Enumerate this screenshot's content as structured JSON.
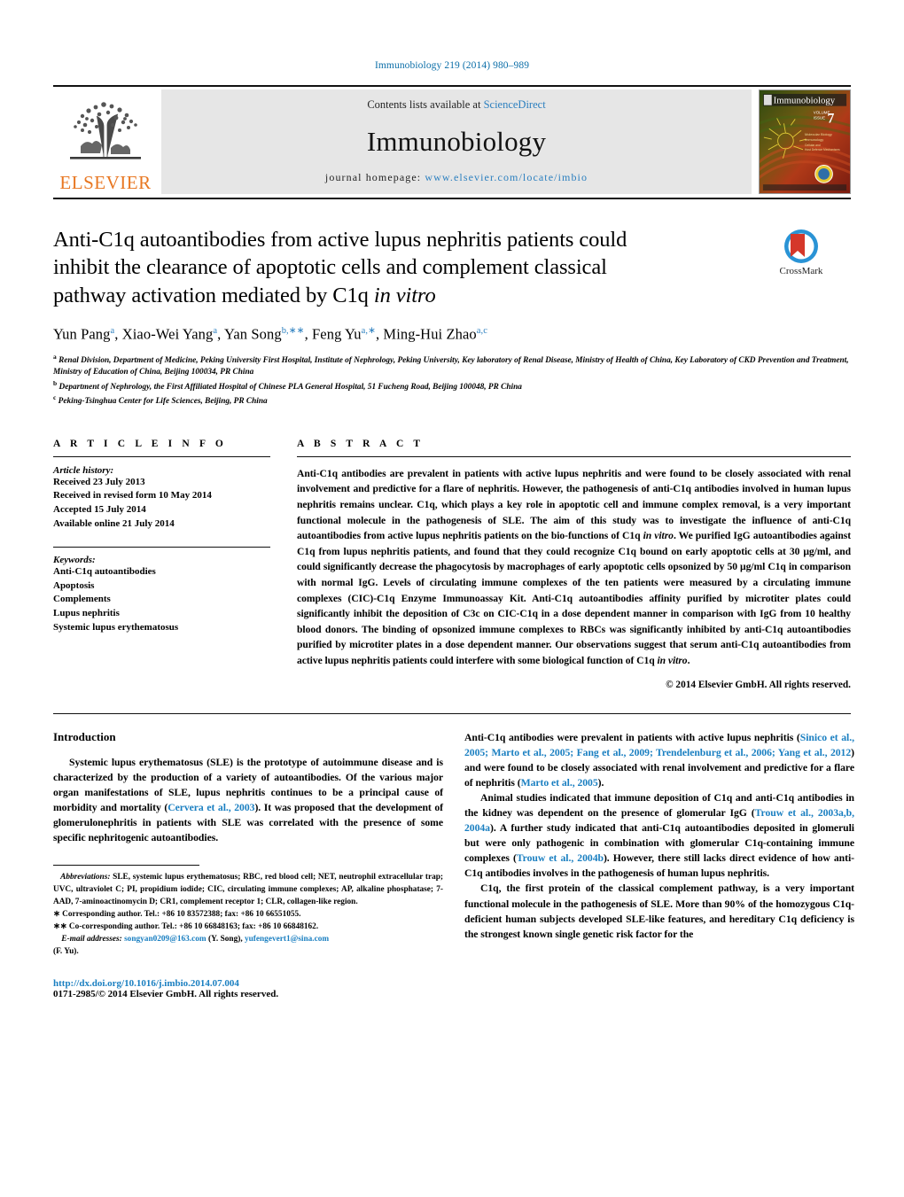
{
  "running_head": "Immunobiology 219 (2014) 980–989",
  "masthead": {
    "publisher": "ELSEVIER",
    "contents_prefix": "Contents lists available at ",
    "contents_link": "ScienceDirect",
    "journal_name": "Immunobiology",
    "homepage_prefix": "journal homepage: ",
    "homepage_url": "www.elsevier.com/locate/imbio",
    "cover_title": "Immunobiology",
    "cover_issue": "7"
  },
  "crossmark": {
    "label": "CrossMark"
  },
  "article": {
    "title_line1": "Anti-C1q autoantibodies from active lupus nephritis patients could",
    "title_line2": "inhibit the clearance of apoptotic cells and complement classical",
    "title_line3_a": "pathway activation mediated by C1q ",
    "title_line3_italic": "in vitro",
    "authors": [
      {
        "name": "Yun Pang",
        "marks": "a"
      },
      {
        "name": "Xiao-Wei Yang",
        "marks": "a"
      },
      {
        "name": "Yan Song",
        "marks": "b,∗∗"
      },
      {
        "name": "Feng Yu",
        "marks": "a,∗"
      },
      {
        "name": "Ming-Hui Zhao",
        "marks": "a,c"
      }
    ],
    "affiliations": [
      {
        "mark": "a",
        "text": "Renal Division, Department of Medicine, Peking University First Hospital, Institute of Nephrology, Peking University, Key laboratory of Renal Disease, Ministry of Health of China, Key Laboratory of CKD Prevention and Treatment, Ministry of Education of China, Beijing 100034, PR China"
      },
      {
        "mark": "b",
        "text": "Department of Nephrology, the First Affiliated Hospital of Chinese PLA General Hospital, 51 Fucheng Road, Beijing 100048, PR China"
      },
      {
        "mark": "c",
        "text": "Peking-Tsinghua Center for Life Sciences, Beijing, PR China"
      }
    ]
  },
  "article_info": {
    "heading": "A R T I C L E   I N F O",
    "history_label": "Article history:",
    "history": [
      "Received 23 July 2013",
      "Received in revised form 10 May 2014",
      "Accepted 15 July 2014",
      "Available online 21 July 2014"
    ],
    "keywords_label": "Keywords:",
    "keywords": [
      "Anti-C1q autoantibodies",
      "Apoptosis",
      "Complements",
      "Lupus nephritis",
      "Systemic lupus erythematosus"
    ]
  },
  "abstract": {
    "heading": "A B S T R A C T",
    "part1": "Anti-C1q antibodies are prevalent in patients with active lupus nephritis and were found to be closely associated with renal involvement and predictive for a flare of nephritis. However, the pathogenesis of anti-C1q antibodies involved in human lupus nephritis remains unclear. C1q, which plays a key role in apoptotic cell and immune complex removal, is a very important functional molecule in the pathogenesis of SLE. The aim of this study was to investigate the influence of anti-C1q autoantibodies from active lupus nephritis patients on the bio-functions of C1q ",
    "italic1": "in vitro",
    "part2": ". We purified IgG autoantibodies against C1q from lupus nephritis patients, and found that they could recognize C1q bound on early apoptotic cells at 30 μg/ml, and could significantly decrease the phagocytosis by macrophages of early apoptotic cells opsonized by 50 μg/ml C1q in comparison with normal IgG. Levels of circulating immune complexes of the ten patients were measured by a circulating immune complexes (CIC)-C1q Enzyme Immunoassay Kit. Anti-C1q autoantibodies affinity purified by microtiter plates could significantly inhibit the deposition of C3c on CIC-C1q in a dose dependent manner in comparison with IgG from 10 healthy blood donors. The binding of opsonized immune complexes to RBCs was significantly inhibited by anti-C1q autoantibodies purified by microtiter plates in a dose dependent manner. Our observations suggest that serum anti-C1q autoantibodies from active lupus nephritis patients could interfere with some biological function of C1q ",
    "italic2": "in vitro",
    "part3": ".",
    "copyright": "© 2014 Elsevier GmbH. All rights reserved."
  },
  "introduction": {
    "heading": "Introduction",
    "left_p1_a": "Systemic lupus erythematosus (SLE) is the prototype of autoimmune disease and is characterized by the production of a variety of autoantibodies. Of the various major organ manifestations of SLE, lupus nephritis continues to be a principal cause of morbidity and mortality (",
    "left_p1_cite": "Cervera et al., 2003",
    "left_p1_b": "). It was proposed that the development of glomerulonephritis in patients with SLE was correlated with the presence of some specific nephritogenic autoantibodies.",
    "right_p1_a": "Anti-C1q antibodies were prevalent in patients with active lupus nephritis (",
    "right_p1_cite": "Sinico et al., 2005; Marto et al., 2005; Fang et al., 2009; Trendelenburg et al., 2006; Yang et al., 2012",
    "right_p1_b": ") and were found to be closely associated with renal involvement and predictive for a flare of nephritis (",
    "right_p1_cite2": "Marto et al., 2005",
    "right_p1_c": ").",
    "right_p2_a": "Animal studies indicated that immune deposition of C1q and anti-C1q antibodies in the kidney was dependent on the presence of glomerular IgG (",
    "right_p2_cite": "Trouw et al., 2003a,b, 2004a",
    "right_p2_b": "). A further study indicated that anti-C1q autoantibodies deposited in glomeruli but were only pathogenic in combination with glomerular C1q-containing immune complexes (",
    "right_p2_cite2": "Trouw et al., 2004b",
    "right_p2_c": "). However, there still lacks direct evidence of how anti-C1q antibodies involves in the pathogenesis of human lupus nephritis.",
    "right_p3": "C1q, the first protein of the classical complement pathway, is a very important functional molecule in the pathogenesis of SLE. More than 90% of the homozygous C1q-deficient human subjects developed SLE-like features, and hereditary C1q deficiency is the strongest known single genetic risk factor for the"
  },
  "footnotes": {
    "abbrev_label": "Abbreviations:",
    "abbrev_text": " SLE, systemic lupus erythematosus; RBC, red blood cell; NET, neutrophil extracellular trap; UVC, ultraviolet C; PI, propidium iodide; CIC, circulating immune complexes; AP, alkaline phosphatase; 7-AAD, 7-aminoactinomycin D; CR1, complement receptor 1; CLR, collagen-like region.",
    "corresponding": "∗ Corresponding author. Tel.: +86 10 83572388; fax: +86 10 66551055.",
    "co_corresponding": "∗∗ Co-corresponding author. Tel.: +86 10 66848163; fax: +86 10 66848162.",
    "email_label": "E-mail addresses:",
    "email1": "songyan0209@163.com",
    "email1_owner": " (Y. Song), ",
    "email2": "yufengevert1@sina.com",
    "email2_owner": "(F. Yu).",
    "doi": "http://dx.doi.org/10.1016/j.imbio.2014.07.004",
    "issn": "0171-2985/© 2014 Elsevier GmbH. All rights reserved."
  },
  "colors": {
    "link_blue": "#1a7fc1",
    "header_blue": "#0b6ea8",
    "elsevier_orange": "#E87722",
    "band_gray": "#e6e6e6"
  }
}
